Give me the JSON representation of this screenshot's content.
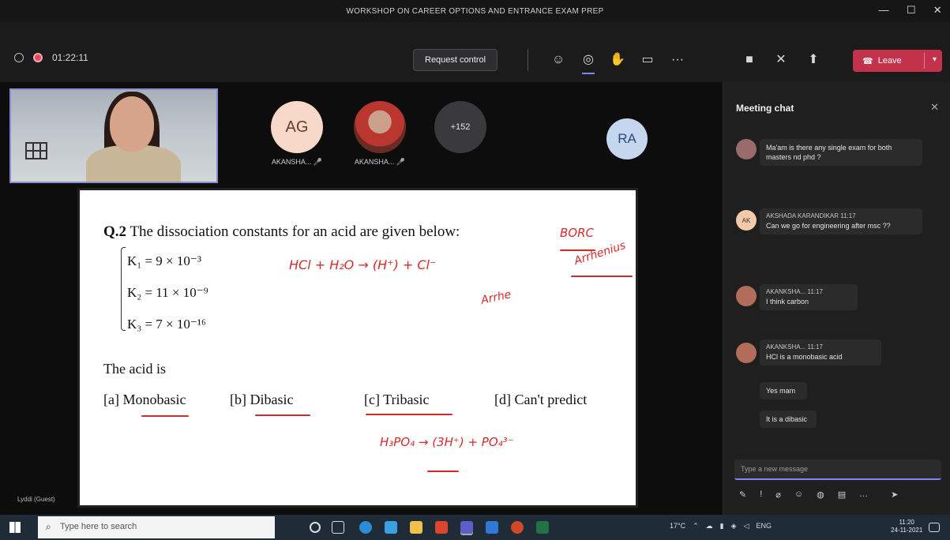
{
  "window": {
    "title": "WORKSHOP ON CAREER OPTIONS AND ENTRANCE EXAM PREP",
    "controls": [
      "—",
      "☐",
      "✕"
    ]
  },
  "toolbar": {
    "timer": "01:22:11",
    "request_control_label": "Request control",
    "more_label": "···",
    "leave_label": "Leave"
  },
  "participants": [
    {
      "initials": "AG",
      "name": "AKANSHA...",
      "bg": "#f6d9c8",
      "fg": "#6b3b2a"
    },
    {
      "initials": "",
      "name": "AKANSHA...",
      "bg": "#b94a3f",
      "fg": "#fff"
    },
    {
      "initials": "+152",
      "name": "",
      "bg": "#3a3a3c",
      "fg": "#e6e6e6"
    },
    {
      "initials": "RA",
      "name": "",
      "bg": "#c5d6ef",
      "fg": "#2b4a7a"
    }
  ],
  "share": {
    "question": "The dissociation constants for an acid are given below:",
    "question_num": "Q.2",
    "k1": "K₁ = 9 × 10⁻³",
    "k2": "K₂ = 11 × 10⁻⁹",
    "k3": "K₃ = 7 × 10⁻¹⁶",
    "acid_is": "The acid is",
    "options": [
      "[a] Monobasic",
      "[b] Dibasic",
      "[c] Tribasic",
      "[d] Can't predict"
    ],
    "ink": {
      "eq1": "HCl + H₂O → (H⁺) + Cl⁻",
      "borc": "BORC",
      "arrhenius": "Arrhenius",
      "protic": "Arrhe",
      "eq2": "H₃PO₄ → (3H⁺) + PO₄³⁻"
    }
  },
  "self_name": "Lyddi (Guest)",
  "chat": {
    "title": "Meeting chat",
    "messages": [
      {
        "avatar": "",
        "sender": "",
        "text": "Ma'am is there any single exam for both masters nd phd ?"
      },
      {
        "avatar": "AK",
        "sender": "AKSHADA KARANDIKAR 11:17",
        "text": "Can we go for engineering after msc ??"
      },
      {
        "avatar": "",
        "sender": "AKANKSHA...  11:17",
        "text": "I think carbon"
      },
      {
        "avatar": "",
        "sender": "AKANKSHA...  11:17",
        "text": "HCl is a monobasic acid"
      },
      {
        "avatar": "",
        "sender": "",
        "text": "Yes mam"
      },
      {
        "avatar": "",
        "sender": "",
        "text": "It is a dibasic"
      }
    ],
    "compose_placeholder": "Type a new message"
  },
  "taskbar": {
    "search_placeholder": "Type here to search",
    "temp": "17°C",
    "lang": "ENG",
    "time": "11:20",
    "date": "24-11-2021"
  }
}
